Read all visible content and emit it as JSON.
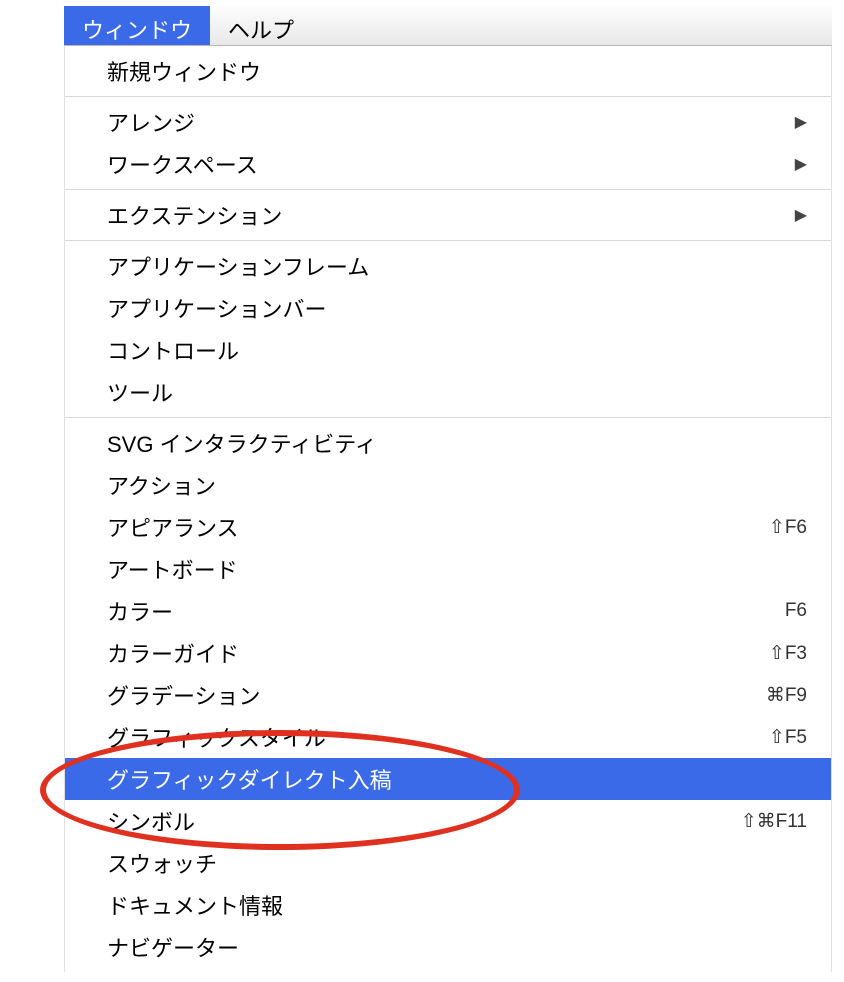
{
  "menubar": {
    "window": "ウィンドウ",
    "help": "ヘルプ"
  },
  "menu": {
    "section1": [
      {
        "label": "新規ウィンドウ",
        "shortcut": "",
        "submenu": false
      }
    ],
    "section2": [
      {
        "label": "アレンジ",
        "shortcut": "",
        "submenu": true
      },
      {
        "label": "ワークスペース",
        "shortcut": "",
        "submenu": true
      }
    ],
    "section3": [
      {
        "label": "エクステンション",
        "shortcut": "",
        "submenu": true
      }
    ],
    "section4": [
      {
        "label": "アプリケーションフレーム",
        "shortcut": "",
        "submenu": false
      },
      {
        "label": "アプリケーションバー",
        "shortcut": "",
        "submenu": false
      },
      {
        "label": "コントロール",
        "shortcut": "",
        "submenu": false
      },
      {
        "label": "ツール",
        "shortcut": "",
        "submenu": false
      }
    ],
    "section5": [
      {
        "label": "SVG インタラクティビティ",
        "shortcut": "",
        "submenu": false
      },
      {
        "label": "アクション",
        "shortcut": "",
        "submenu": false
      },
      {
        "label": "アピアランス",
        "shortcut": "⇧F6",
        "submenu": false
      },
      {
        "label": "アートボード",
        "shortcut": "",
        "submenu": false
      },
      {
        "label": "カラー",
        "shortcut": "F6",
        "submenu": false
      },
      {
        "label": "カラーガイド",
        "shortcut": "⇧F3",
        "submenu": false
      },
      {
        "label": "グラデーション",
        "shortcut": "⌘F9",
        "submenu": false
      },
      {
        "label": "グラフィックスタイル",
        "shortcut": "⇧F5",
        "submenu": false
      },
      {
        "label": "グラフィックダイレクト入稿",
        "shortcut": "",
        "submenu": false,
        "highlighted": true
      },
      {
        "label": "シンボル",
        "shortcut": "⇧⌘F11",
        "submenu": false
      },
      {
        "label": "スウォッチ",
        "shortcut": "",
        "submenu": false
      },
      {
        "label": "ドキュメント情報",
        "shortcut": "",
        "submenu": false
      },
      {
        "label": "ナビゲーター",
        "shortcut": "",
        "submenu": false
      }
    ]
  }
}
